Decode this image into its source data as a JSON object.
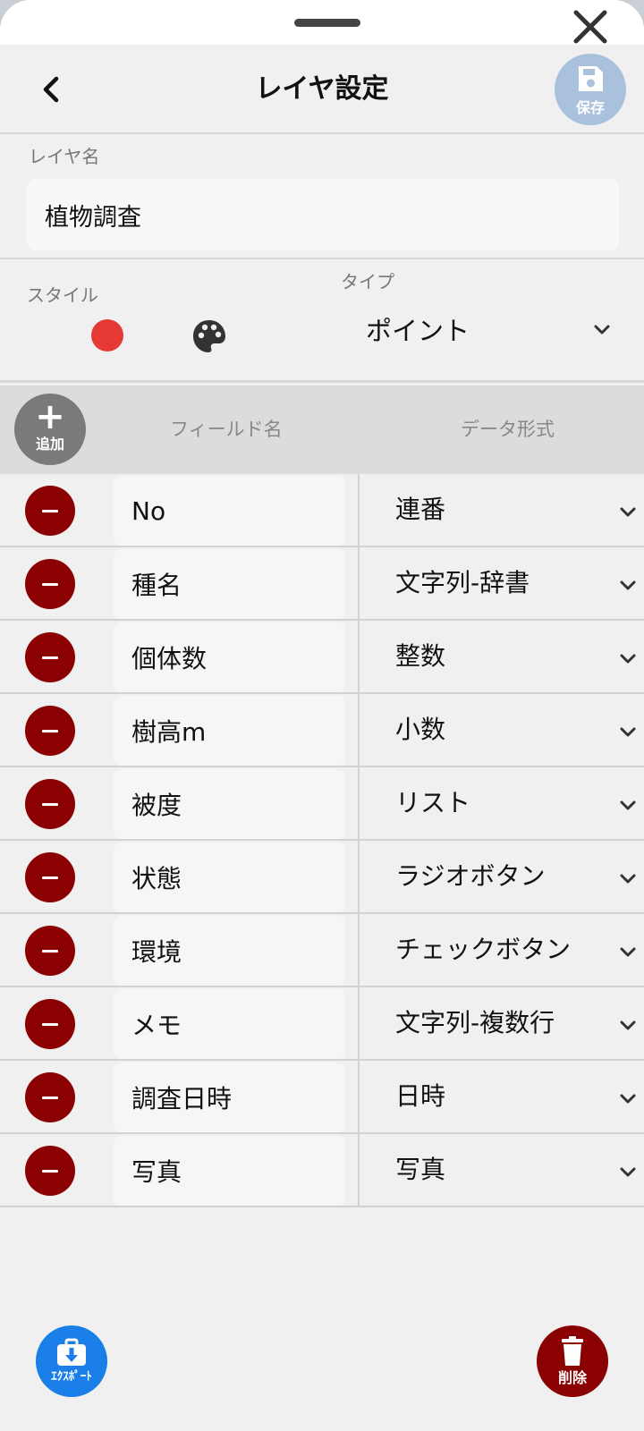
{
  "header": {
    "title": "レイヤ設定",
    "save_label": "保存"
  },
  "layer_name": {
    "label": "レイヤ名",
    "value": "植物調査"
  },
  "style": {
    "label": "スタイル",
    "color": "#e53935",
    "palette_icon": "palette-icon"
  },
  "type": {
    "label": "タイプ",
    "value": "ポイント"
  },
  "table": {
    "add_label": "追加",
    "field_name_header": "フィールド名",
    "data_type_header": "データ形式",
    "rows": [
      {
        "field": "No",
        "type": "連番"
      },
      {
        "field": "種名",
        "type": "文字列-辞書"
      },
      {
        "field": "個体数",
        "type": "整数"
      },
      {
        "field": "樹高m",
        "type": "小数"
      },
      {
        "field": "被度",
        "type": "リスト"
      },
      {
        "field": "状態",
        "type": "ラジオボタン"
      },
      {
        "field": "環境",
        "type": "チェックボタン"
      },
      {
        "field": "メモ",
        "type": "文字列-複数行"
      },
      {
        "field": "調査日時",
        "type": "日時"
      },
      {
        "field": "写真",
        "type": "写真"
      }
    ]
  },
  "footer": {
    "export_label": "ｴｸｽﾎﾟｰﾄ",
    "delete_label": "削除"
  },
  "colors": {
    "remove": "#8b0000",
    "save": "#a9c1dd",
    "export": "#1a7fe8",
    "delete": "#8b0000",
    "add": "#7a7a7a"
  }
}
